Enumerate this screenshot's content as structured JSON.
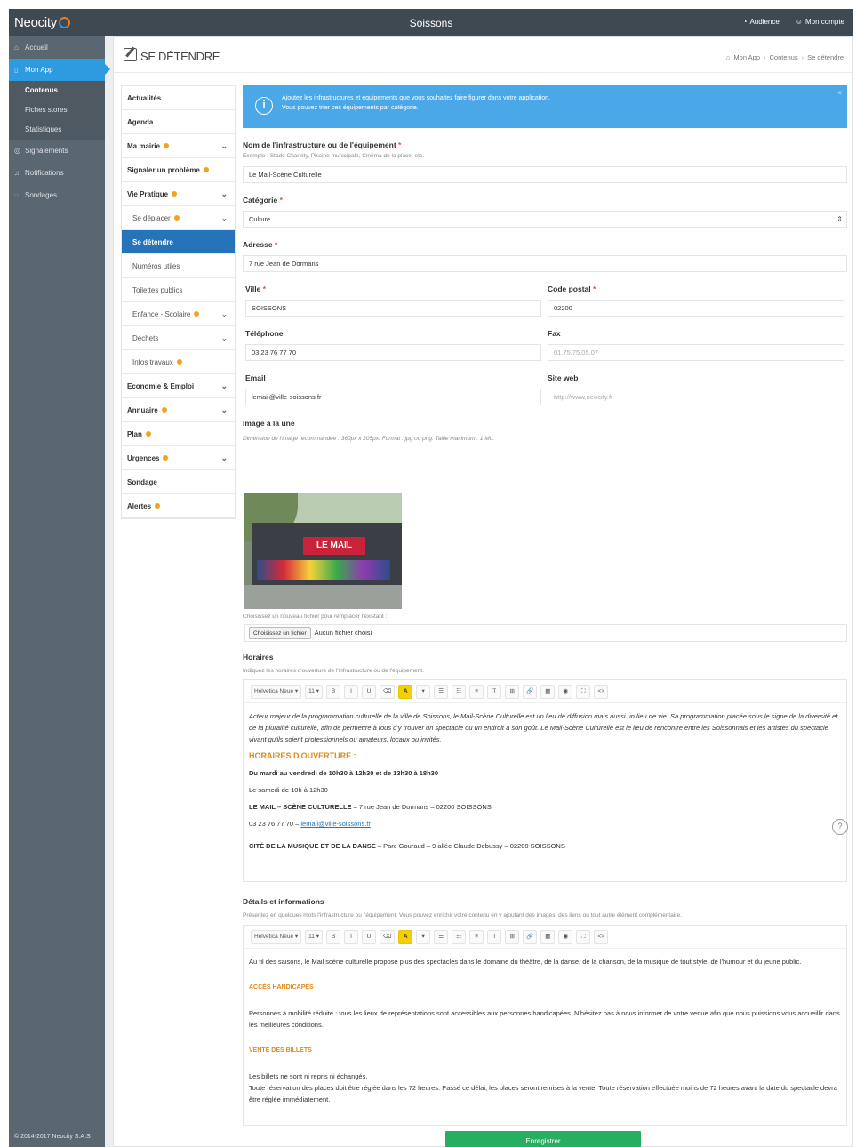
{
  "topbar": {
    "logo": "Neocity",
    "title": "Soissons",
    "audience": "Audience",
    "account": "Mon compte"
  },
  "sidebar": {
    "items": [
      {
        "label": "Accueil"
      },
      {
        "label": "Mon App"
      },
      {
        "label": "Signalements"
      },
      {
        "label": "Notifications"
      },
      {
        "label": "Sondages"
      }
    ],
    "subitems": [
      {
        "label": "Contenus"
      },
      {
        "label": "Fiches stores"
      },
      {
        "label": "Statistiques"
      }
    ],
    "copyright": "© 2014-2017 Neocity S.A.S"
  },
  "page": {
    "title": "SE DÉTENDRE",
    "breadcrumb": [
      "Mon App",
      "Contenus",
      "Se détendre"
    ]
  },
  "subnav": [
    {
      "label": "Actualités"
    },
    {
      "label": "Agenda"
    },
    {
      "label": "Ma mairie"
    },
    {
      "label": "Signaler un problème"
    },
    {
      "label": "Vie Pratique"
    },
    {
      "label": "Se déplacer"
    },
    {
      "label": "Se détendre"
    },
    {
      "label": "Numéros utiles"
    },
    {
      "label": "Toilettes publics"
    },
    {
      "label": "Enfance - Scolaire"
    },
    {
      "label": "Déchets"
    },
    {
      "label": "Infos travaux"
    },
    {
      "label": "Economie & Emploi"
    },
    {
      "label": "Annuaire"
    },
    {
      "label": "Plan"
    },
    {
      "label": "Urgences"
    },
    {
      "label": "Sondage"
    },
    {
      "label": "Alertes"
    }
  ],
  "info": {
    "line1": "Ajoutez les infrastructures et équipements que vous souhaitez faire figurer dans votre application.",
    "line2": "Vous pouvez trier ces équipements par catégorie."
  },
  "form": {
    "name_label": "Nom de l'infrastructure ou de l'équipement",
    "name_hint": "Exemple : Stade Charléty, Piscine municipale, Cinéma de la place, etc.",
    "name_value": "Le Mail-Scène Culturelle",
    "category_label": "Catégorie",
    "category_value": "Culture",
    "address_label": "Adresse",
    "address_value": "7 rue Jean de Dormans",
    "city_label": "Ville",
    "city_value": "SOISSONS",
    "zip_label": "Code postal",
    "zip_value": "02200",
    "phone_label": "Téléphone",
    "phone_value": "03 23 76 77 70",
    "fax_label": "Fax",
    "fax_placeholder": "01.75.75.05.07",
    "email_label": "Email",
    "email_value": "lemail@ville-soissons.fr",
    "web_label": "Site web",
    "web_placeholder": "http://www.neocity.fr",
    "image_label": "Image à la une",
    "image_hint": "Dimension de l'image recommandée : 360px x 205px. Format : jpg ou png. Taille maximum : 1 Mo.",
    "image_sign": "LE MAIL",
    "file_hint": "Choisissez un nouveau fichier pour remplacer l'existant :",
    "file_button": "Choisissez un fichier",
    "file_status": "Aucun fichier choisi",
    "hours_label": "Horaires",
    "hours_hint": "Indiquez les horaires d'ouverture de l'infrastructure ou de l'équipement.",
    "details_label": "Détails et informations",
    "details_hint": "Présentez en quelques mots l'infrastructure ou l'équipement. Vous pouvez enrichir votre contenu en y ajoutant des images, des liens ou tout autre élément complémentaire.",
    "save_label": "Enregistrer"
  },
  "toolbar": {
    "font": "Helvetica Neue",
    "size": "11",
    "buttons": [
      "B",
      "I",
      "U",
      "⌫",
      "A",
      "▾",
      "☰",
      "☷",
      "≡",
      "T",
      "⊞",
      "🔗",
      "▦",
      "◉",
      "⛶",
      "<>"
    ]
  },
  "hours_editor": {
    "intro": "Acteur majeur de la programmation culturelle de la ville de Soissons, le Mail-Scène Culturelle est un lieu de diffusion mais aussi un lieu de vie. Sa programmation placée sous le signe de la diversité et de la pluralité culturelle, afin de permettre à tous d'y trouver un spectacle ou un endroit à son goût. Le Mail-Scène Culturelle est le lieu de rencontre entre les Soissonnais et les artistes du spectacle vivant qu'ils soient professionnels ou amateurs, locaux ou invités.",
    "heading": "HORAIRES D'OUVERTURE :",
    "line1": "Du mardi au vendredi de 10h30 à 12h30 et de 13h30 à 18h30",
    "line2": "Le samedi de 10h à 12h30",
    "venue1_name": "LE MAIL – SCÈNE CULTURELLE",
    "venue1_addr": " – 7 rue Jean de Dormans – 02200 SOISSONS",
    "venue1_phone": "03 23 76 77 70 – ",
    "venue1_email": "lemail@ville-soissons.fr",
    "venue2_name": "CITÉ DE LA MUSIQUE ET DE LA DANSE",
    "venue2_addr": " – Parc Gouraud – 9 allée Claude Debussy – 02200 SOISSONS"
  },
  "details_editor": {
    "intro": "Au fil des saisons, le Mail scène culturelle propose plus des spectacles dans le domaine du théâtre, de la danse, de la chanson, de la musique de tout style, de l'humour et du jeune public.",
    "h1": "ACCÈS HANDICAPÉS",
    "p1": "Personnes à mobilité réduite : tous les lieux de représentations sont accessibles aux personnes handicapées. N'hésitez pas à nous informer de votre venue afin que nous puissions vous accueillir dans les meilleures conditions.",
    "h2": "VENTE DES BILLETS",
    "p2a": "Les billets ne sont ni repris ni échangés.",
    "p2b": "Toute réservation des places doit être réglée dans les 72 heures. Passé ce délai, les places seront remises à la vente. Toute réservation effectuée moins de 72 heures avant la date du spectacle devra être réglée immédiatement."
  },
  "colors": {
    "topbar": "#3e4952",
    "sidebar": "#5a6670",
    "accent": "#2e9be0",
    "active_nav": "#2574b9",
    "info": "#4aa8e8",
    "save": "#27ae60",
    "badge": "#f2a21e"
  }
}
